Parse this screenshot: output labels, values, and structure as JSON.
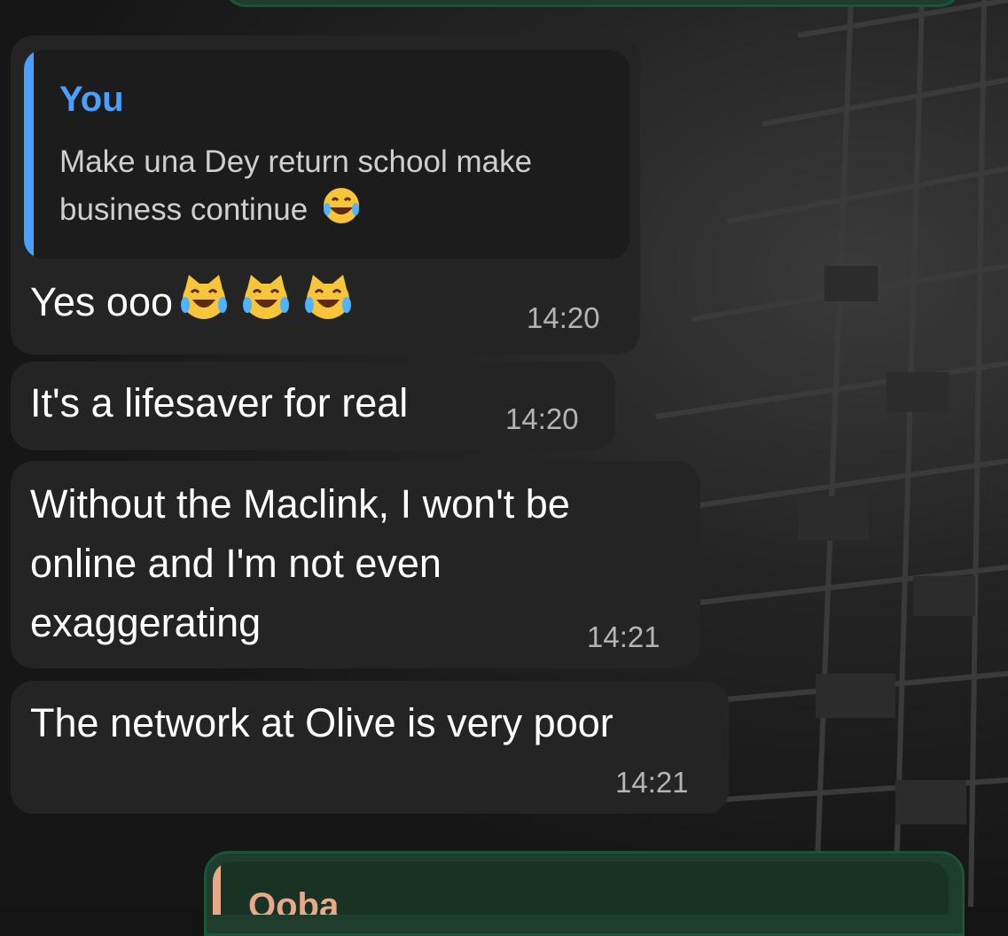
{
  "chat": {
    "quoted_reply": {
      "author": "You",
      "text": "Make una Dey return school make business continue",
      "emoji_icon": "face-with-tears-of-joy-icon"
    },
    "messages": [
      {
        "text": "Yes ooo",
        "emoji_icons": [
          "cat-with-tears-of-joy-icon",
          "cat-with-tears-of-joy-icon",
          "cat-with-tears-of-joy-icon"
        ],
        "time": "14:20"
      },
      {
        "text": "It's a lifesaver for real",
        "time": "14:20"
      },
      {
        "text_lines": [
          "Without the Maclink, I won't be",
          "online and I'm not even",
          "exaggerating"
        ],
        "time": "14:21"
      },
      {
        "text": "The network at Olive is very poor",
        "time": "14:21"
      }
    ],
    "next_outgoing_quote": {
      "author_partial": "Ooba"
    }
  },
  "colors": {
    "incoming_bubble": "#242424",
    "outgoing_bubble": "#1e3d2c",
    "quote_author_blue": "#4ba0ff",
    "quote_bar_peach": "#e8a98a"
  }
}
